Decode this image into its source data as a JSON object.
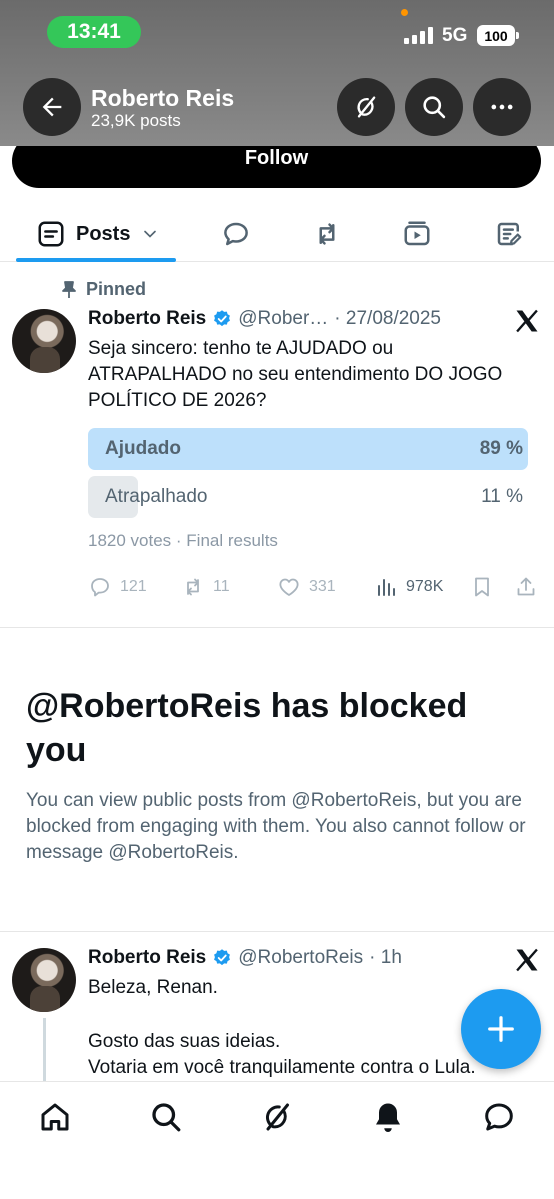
{
  "status_bar": {
    "time": "13:41",
    "network": "5G",
    "battery": "100"
  },
  "header": {
    "name": "Roberto Reis",
    "post_count": "23,9K posts"
  },
  "follow_label": "Follow",
  "tabs": {
    "posts_label": "Posts"
  },
  "pinned_post": {
    "pinned_label": "Pinned",
    "author": "Roberto Reis",
    "handle": "@Rober…",
    "date": "· 27/08/2025",
    "text": "Seja sincero: tenho te AJUDADO ou ATRAPALHADO no seu entendimento DO JOGO POLÍTICO DE 2026?",
    "poll": {
      "options": [
        {
          "label": "Ajudado",
          "percent_text": "89 %",
          "percent": 89
        },
        {
          "label": "Atrapalhado",
          "percent_text": "11 %",
          "percent": 11
        }
      ],
      "meta": "1820 votes · Final results"
    },
    "stats": {
      "replies": "121",
      "reposts": "11",
      "likes": "331",
      "views": "978K"
    }
  },
  "blocked_notice": {
    "title": "@RobertoReis has blocked you",
    "text": "You can view public posts from @RobertoReis, but you are blocked from engaging with them. You also cannot follow or message @RobertoReis."
  },
  "second_post": {
    "author": "Roberto Reis",
    "handle": "@RobertoReis",
    "time": "· 1h",
    "line1": "Beleza, Renan.",
    "line2": "Gosto das suas ideias.",
    "line3": "Votaria em você tranquilamente contra o Lula."
  },
  "colors": {
    "accent": "#1d9bf0",
    "poll_winner": "#bde0fb",
    "poll_other": "#e5e9ec",
    "status_pill": "#34c759"
  }
}
